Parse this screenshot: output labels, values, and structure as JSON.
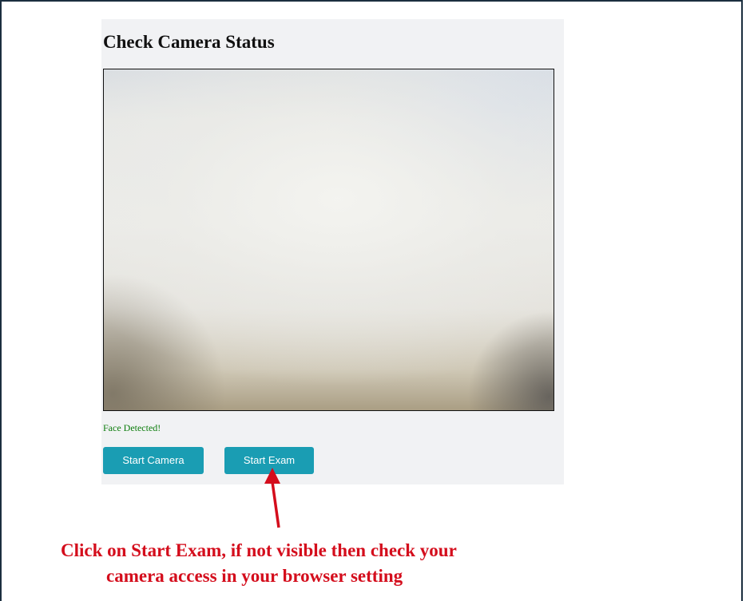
{
  "panel": {
    "title": "Check Camera Status",
    "status_text": "Face Detected!",
    "status_color": "#0d7d0d"
  },
  "buttons": {
    "start_camera": "Start Camera",
    "start_exam": "Start Exam",
    "color": "#1a9db3"
  },
  "annotation": {
    "line1": "Click on Start Exam, if not visible then check your",
    "line2": "camera access in your browser setting",
    "color": "#d40d1c",
    "arrow_icon": "arrow-up-icon"
  }
}
